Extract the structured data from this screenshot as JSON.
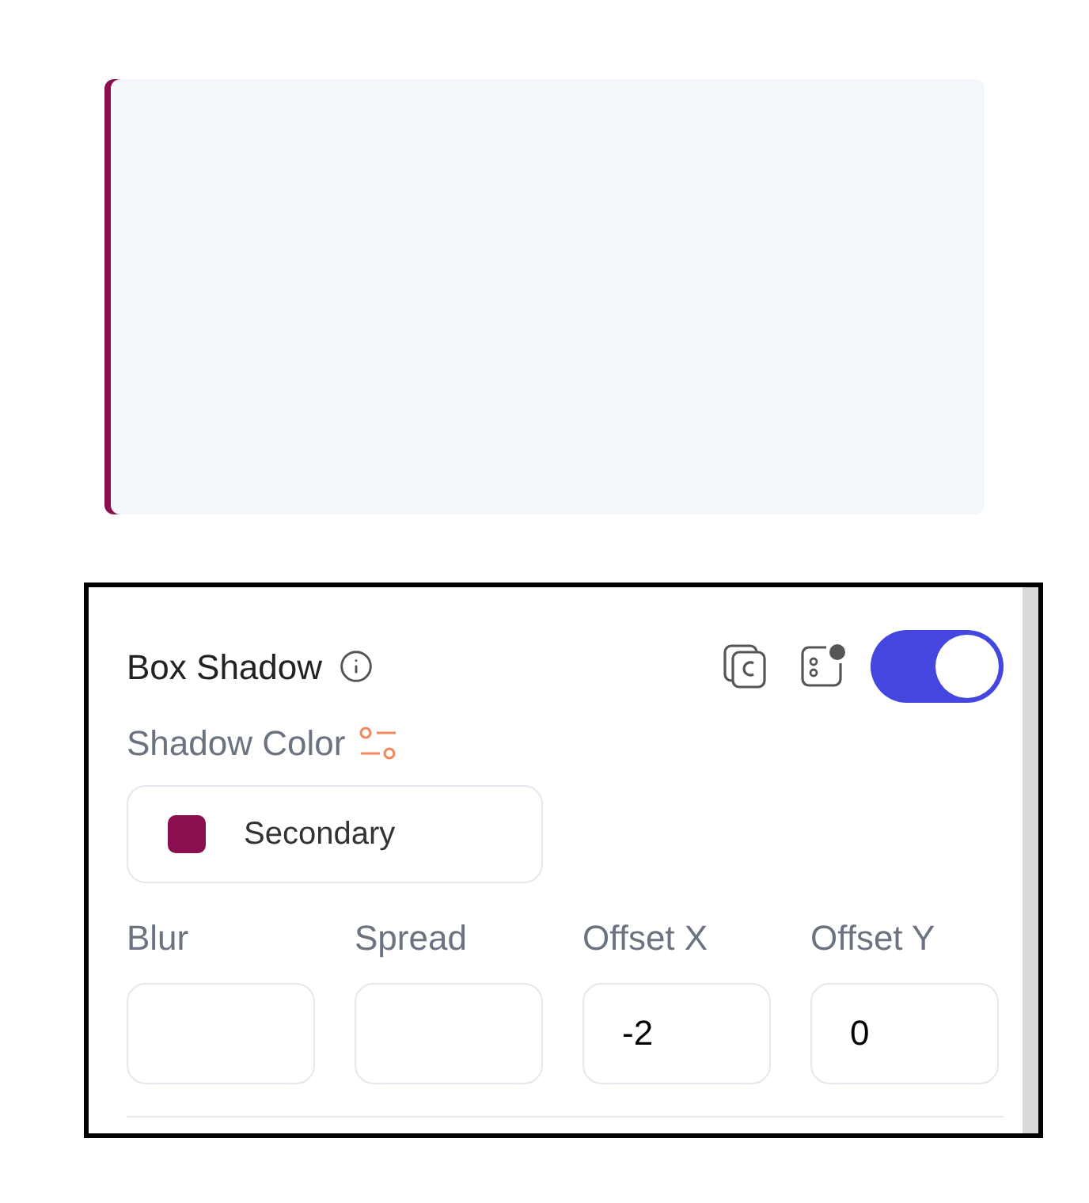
{
  "box_shadow": {
    "title": "Box Shadow",
    "on": true,
    "shadow_color": {
      "label": "Shadow Color",
      "value": "Secondary",
      "color": "#8b0f4e"
    },
    "fields": [
      {
        "label": "Blur"
      },
      {
        "label": "Spread"
      },
      {
        "label": "Offset X",
        "value": "-2"
      },
      {
        "label": "Offset Y",
        "value": "0"
      }
    ]
  }
}
